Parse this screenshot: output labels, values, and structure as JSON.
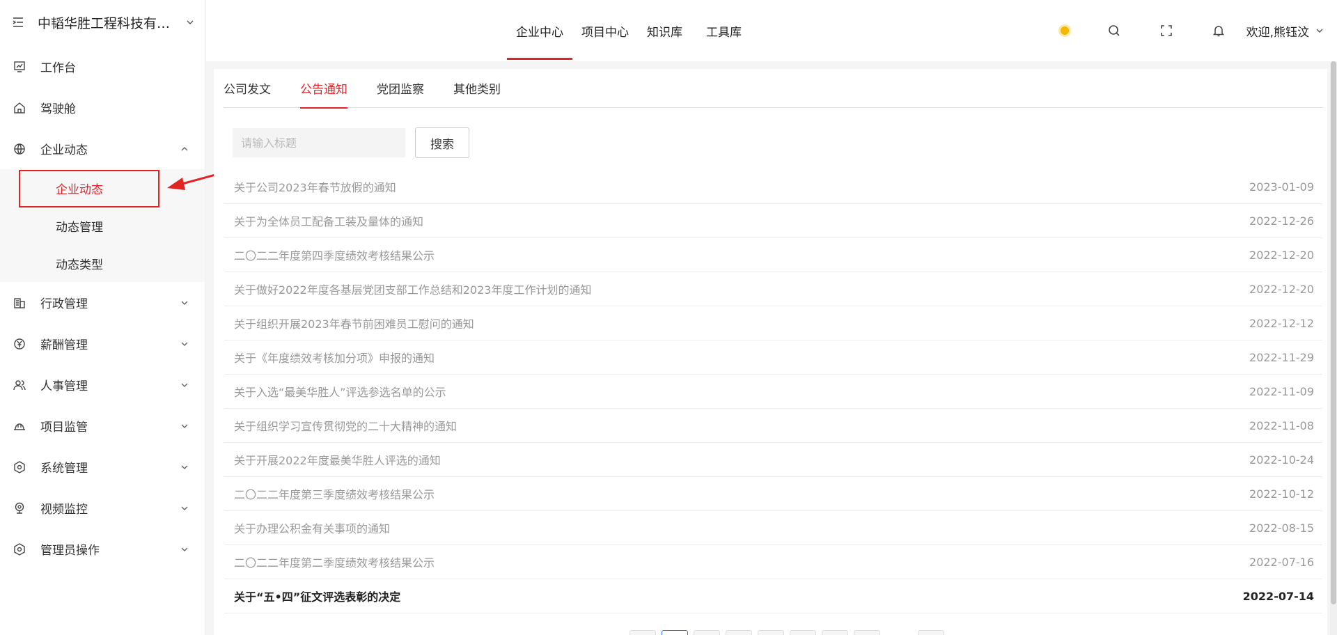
{
  "sidebar": {
    "company": "中韬华胜工程科技有限...",
    "items": [
      {
        "label": "工作台"
      },
      {
        "label": "驾驶舱"
      },
      {
        "label": "企业动态"
      },
      {
        "label": "行政管理"
      },
      {
        "label": "薪酬管理"
      },
      {
        "label": "人事管理"
      },
      {
        "label": "项目监管"
      },
      {
        "label": "系统管理"
      },
      {
        "label": "视频监控"
      },
      {
        "label": "管理员操作"
      }
    ],
    "submenu": [
      {
        "label": "企业动态"
      },
      {
        "label": "动态管理"
      },
      {
        "label": "动态类型"
      }
    ]
  },
  "header": {
    "tabs": [
      {
        "label": "企业中心"
      },
      {
        "label": "项目中心"
      },
      {
        "label": "知识库"
      },
      {
        "label": "工具库"
      }
    ],
    "welcome": "欢迎,熊钰汶"
  },
  "main": {
    "category_tabs": [
      {
        "label": "公司发文"
      },
      {
        "label": "公告通知"
      },
      {
        "label": "党团监察"
      },
      {
        "label": "其他类别"
      }
    ],
    "search": {
      "placeholder": "请输入标题",
      "button": "搜索"
    },
    "notices": [
      {
        "title": "关于公司2023年春节放假的通知",
        "date": "2023-01-09"
      },
      {
        "title": "关于为全体员工配备工装及量体的通知",
        "date": "2022-12-26"
      },
      {
        "title": "二〇二二年度第四季度绩效考核结果公示",
        "date": "2022-12-20"
      },
      {
        "title": "关于做好2022年度各基层党团支部工作总结和2023年度工作计划的通知",
        "date": "2022-12-20"
      },
      {
        "title": "关于组织开展2023年春节前困难员工慰问的通知",
        "date": "2022-12-12"
      },
      {
        "title": "关于《年度绩效考核加分项》申报的通知",
        "date": "2022-11-29"
      },
      {
        "title": "关于入选“最美华胜人”评选参选名单的公示",
        "date": "2022-11-09"
      },
      {
        "title": "关于组织学习宣传贯彻党的二十大精神的通知",
        "date": "2022-11-08"
      },
      {
        "title": "关于开展2022年度最美华胜人评选的通知",
        "date": "2022-10-24"
      },
      {
        "title": "二〇二二年度第三季度绩效考核结果公示",
        "date": "2022-10-12"
      },
      {
        "title": "关于办理公积金有关事项的通知",
        "date": "2022-08-15"
      },
      {
        "title": "二〇二二年度第二季度绩效考核结果公示",
        "date": "2022-07-16"
      },
      {
        "title": "关于“五•四”征文评选表彰的决定",
        "date": "2022-07-14"
      }
    ]
  },
  "colors": {
    "accent": "#d9262b",
    "highlight_box": "#e02424",
    "sun": "#f5b800",
    "page_active": "#2f6ff0"
  }
}
